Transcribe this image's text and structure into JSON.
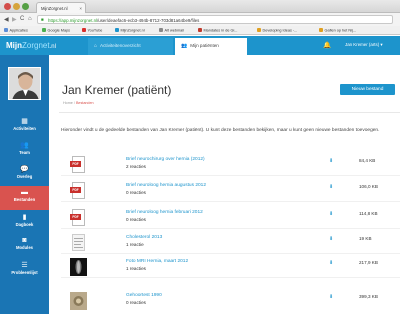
{
  "browser": {
    "tab_title": "MijnZorgnet.nl",
    "tab_close": "×",
    "url_scheme": "https://",
    "url_host": "app.mijnzorgnet.nl",
    "url_path": "/user/deaefac6-ecb3-494b-8712-703d81a64be9/files",
    "nav": {
      "back": "◀",
      "forward": "▶",
      "reload": "C",
      "home": "⌂"
    },
    "bookmarks": [
      "Applicaties",
      "Google Maps",
      "YouTube",
      "MijnZorgnet.nl",
      "Alt webmail",
      "Mandates in de Gi...",
      "Developing Ideas -...",
      "Gaflen op het Nij..."
    ]
  },
  "app": {
    "logo_a": "Mijn",
    "logo_b": "Zorgnet",
    "logo_c": ".nl",
    "tabs": [
      {
        "label": "Activiteitenoverzicht",
        "icon": "home-icon"
      },
      {
        "label": "Mijn patiënten",
        "icon": "people-icon"
      }
    ],
    "user": "Jan Kremer (arts) ▾",
    "brand_color": "#1d94cc"
  },
  "sidebar": {
    "items": [
      {
        "label": "Activiteiten",
        "icon": "calendar-icon"
      },
      {
        "label": "Team",
        "icon": "team-icon"
      },
      {
        "label": "Overleg",
        "icon": "chat-icon"
      },
      {
        "label": "Bestanden",
        "icon": "folder-icon",
        "active": true
      },
      {
        "label": "Dagboek",
        "icon": "book-icon"
      },
      {
        "label": "Modules",
        "icon": "camera-icon"
      },
      {
        "label": "Probleemlijst",
        "icon": "list-icon"
      }
    ]
  },
  "main": {
    "title": "Jan Kremer (patiënt)",
    "breadcrumb_home": "Home",
    "breadcrumb_sep": "/",
    "breadcrumb_current": "Bestanden",
    "new_file_label": "Nieuw bestand",
    "intro": "Hieronder vindt u de gedeelde bestanden van Jan Kremer (patiënt). U kunt deze bestanden bekijken, maar u kunt geen nieuwe bestanden toevoegen."
  },
  "files": [
    {
      "name": "Brief neurochirurg over hernia (2012)",
      "reacties": "2 reacties",
      "size": "84,4 KB",
      "type": "pdf"
    },
    {
      "name": "Brief neuroloog hernia augustus 2012",
      "reacties": "0 reacties",
      "size": "106,0 KB",
      "type": "pdf"
    },
    {
      "name": "Brief neuroloog hernia februari 2012",
      "reacties": "0 reacties",
      "size": "114,8 KB",
      "type": "pdf"
    },
    {
      "name": "Cholesterol 2013",
      "reacties": "1 reactie",
      "size": "19 KB",
      "type": "doc"
    },
    {
      "name": "Foto MRI Hernia, maart 2012",
      "reacties": "1 reacties",
      "size": "217,9 KB",
      "type": "mri"
    },
    {
      "name": "Gehoortest 1990",
      "reacties": "0 reacties",
      "size": "399,3 KB",
      "type": "scan"
    }
  ]
}
